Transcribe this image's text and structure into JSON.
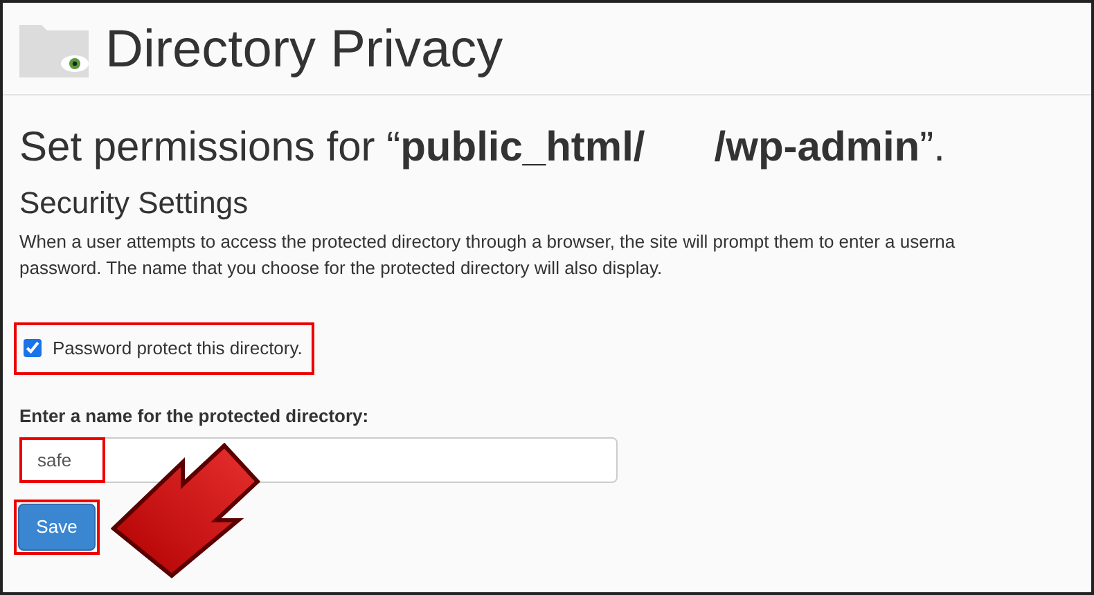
{
  "header": {
    "title": "Directory Privacy"
  },
  "heading": "Set permissions for “**public_html/      /wp-admin**”.",
  "section": {
    "title": "Security Settings",
    "description": [
      "When a user attempts to access the protected directory through a browser, the site will prompt them to enter a userna",
      "password. The name that you choose for the protected directory will also display."
    ]
  },
  "protect_checkbox": {
    "label": "Password protect this directory.",
    "checked": true
  },
  "name_field": {
    "label": "Enter a name for the protected directory:",
    "value": "safe"
  },
  "buttons": [
    "Save"
  ]
}
